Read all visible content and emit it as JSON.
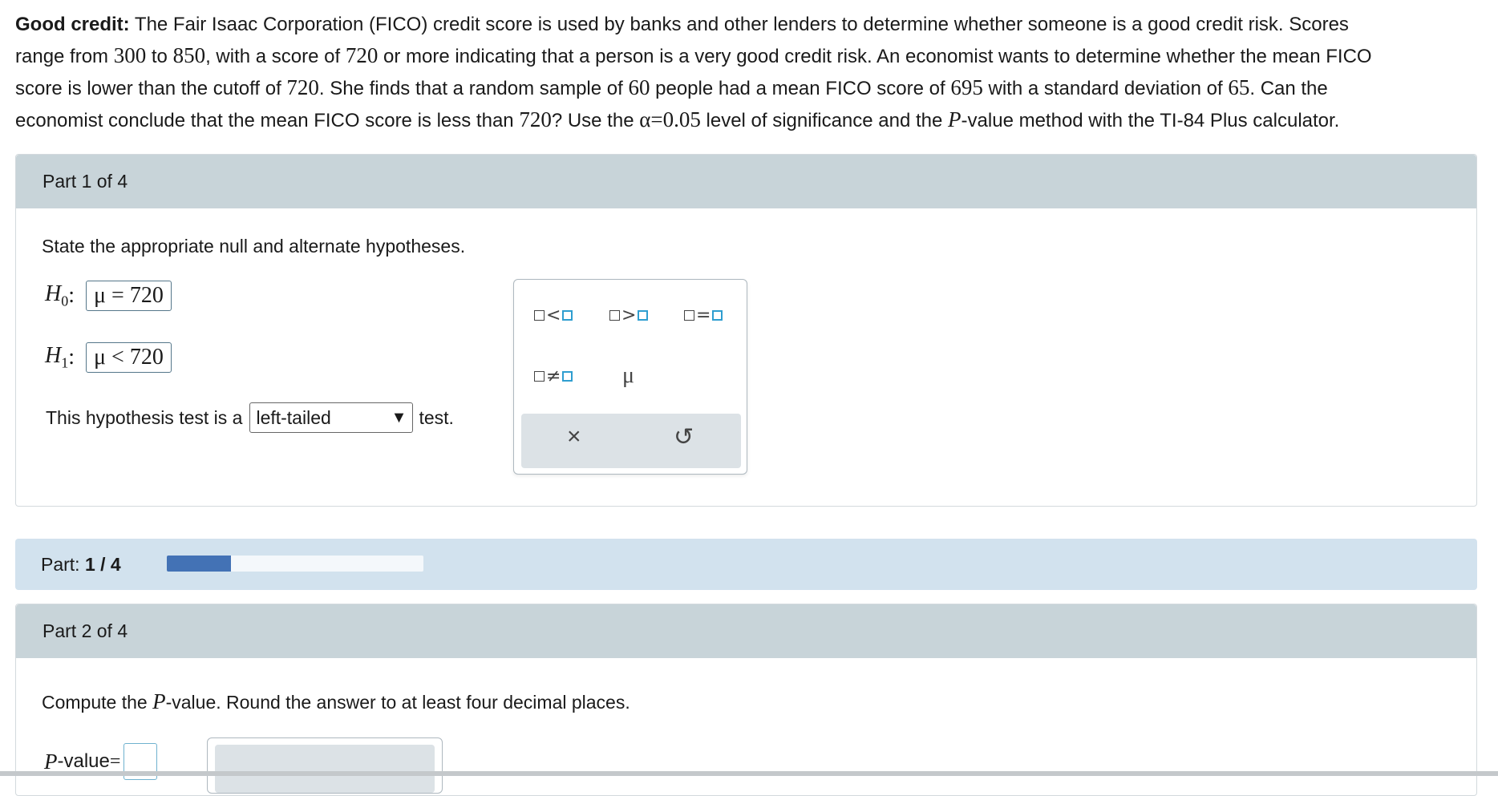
{
  "problem": {
    "bold_lead": "Good credit:",
    "line1_rest": " The Fair Isaac Corporation (FICO) credit score is used by banks and other lenders to determine whether someone is a good credit risk. Scores",
    "line2_a": "range from ",
    "n300": "300",
    "line2_b": " to ",
    "n850": "850",
    "line2_c": ", with a score of ",
    "n720a": "720",
    "line2_d": " or more indicating that a person is a very good credit risk. An economist wants to determine whether the mean FICO",
    "line3_a": "score is lower than the cutoff of ",
    "n720b": "720",
    "line3_b": ". She finds that a random sample of ",
    "n60": "60",
    "line3_c": " people had a mean FICO score of ",
    "n695": "695",
    "line3_d": " with a standard deviation of ",
    "n65": "65",
    "line3_e": ". Can the",
    "line4_a": "economist conclude that the mean FICO score is less than ",
    "n720c": "720",
    "line4_b": "? Use the ",
    "alpha": "α=0.05",
    "line4_c": " level of significance and the ",
    "P": "P",
    "line4_d": "-value method with the TI-84 Plus calculator."
  },
  "part1": {
    "header": "Part 1 of 4",
    "instruction": "State the appropriate null and alternate hypotheses.",
    "h0_label": "H",
    "h0_sub": "0",
    "h0_value": "μ = 720",
    "h1_label": "H",
    "h1_sub": "1",
    "h1_value": "μ < 720",
    "colon": ":",
    "test_prefix": "This hypothesis test is a",
    "test_selected": "left-tailed",
    "test_suffix": "test."
  },
  "palette": {
    "lt": "<",
    "gt": ">",
    "eq": "=",
    "neq": "≠",
    "mu": "μ",
    "clear": "×",
    "undo": "↺"
  },
  "progress": {
    "label": "Part:",
    "value": "1 / 4",
    "fraction": 0.25,
    "color": "#4372b5"
  },
  "part2": {
    "header": "Part 2 of 4",
    "instr_a": "Compute the ",
    "instr_P": "P",
    "instr_b": "-value. Round the answer to at least four decimal places.",
    "pvalue_P": "P",
    "pvalue_label": "-value",
    "equals": "="
  }
}
